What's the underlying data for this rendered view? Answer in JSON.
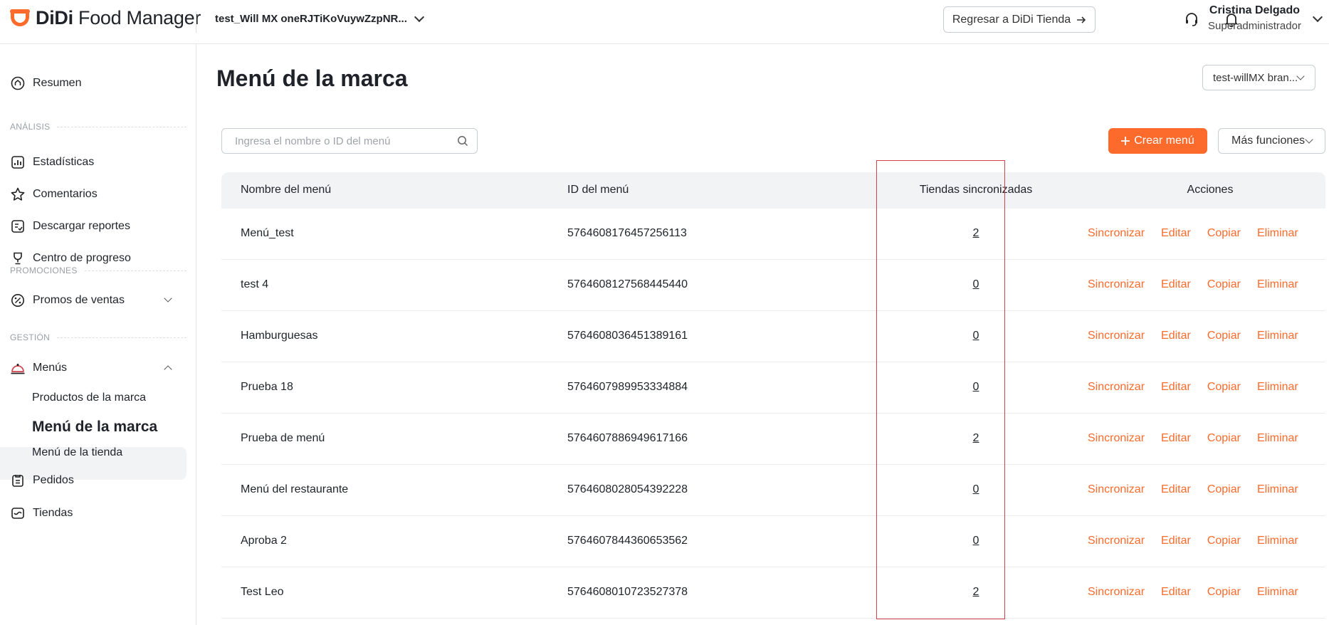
{
  "header": {
    "logo_bold": "DiDi",
    "logo_rest": " Food Manager",
    "store_name": "test_Will MX oneRJTiKoVuywZzpNR...",
    "return_label": "Regresar a DiDi Tienda",
    "user_name": "Cristina Delgado",
    "user_role": "Superadministrador"
  },
  "sidebar": {
    "resumen": "Resumen",
    "section_analisis": "ANÁLISIS",
    "estadisticas": "Estadísticas",
    "comentarios": "Comentarios",
    "descargar": "Descargar reportes",
    "progreso": "Centro de progreso",
    "section_promociones": "PROMOCIONES",
    "promos": "Promos de ventas",
    "section_gestion": "GESTIÓN",
    "menus": "Menús",
    "productos_marca": "Productos de la marca",
    "menu_marca": "Menú de la marca",
    "menu_tienda": "Menú de la tienda",
    "pedidos": "Pedidos",
    "tiendas": "Tiendas"
  },
  "main": {
    "title": "Menú de la marca",
    "brand_select": "test-willMX bran...",
    "search_placeholder": "Ingresa el nombre o ID del menú",
    "create_label": "Crear menú",
    "more_label": "Más funciones"
  },
  "table": {
    "headers": {
      "name": "Nombre del menú",
      "id": "ID del menú",
      "stores": "Tiendas sincronizadas",
      "actions": "Acciones"
    },
    "action_labels": {
      "sync": "Sincronizar",
      "edit": "Editar",
      "copy": "Copiar",
      "delete": "Eliminar"
    },
    "rows": [
      {
        "name": "Menú_test",
        "id": "5764608176457256113",
        "stores": "2"
      },
      {
        "name": "test 4",
        "id": "5764608127568445440",
        "stores": "0"
      },
      {
        "name": "Hamburguesas",
        "id": "5764608036451389161",
        "stores": "0"
      },
      {
        "name": "Prueba 18",
        "id": "5764607989953334884",
        "stores": "0"
      },
      {
        "name": "Prueba de menú",
        "id": "5764607886949617166",
        "stores": "2"
      },
      {
        "name": "Menú del restaurante",
        "id": "5764608028054392228",
        "stores": "0"
      },
      {
        "name": "Aproba 2",
        "id": "5764607844360653562",
        "stores": "0"
      },
      {
        "name": "Test Leo",
        "id": "5764608010723527378",
        "stores": "2"
      }
    ]
  },
  "colors": {
    "accent": "#fc6a2c",
    "highlight": "#d0424d"
  }
}
